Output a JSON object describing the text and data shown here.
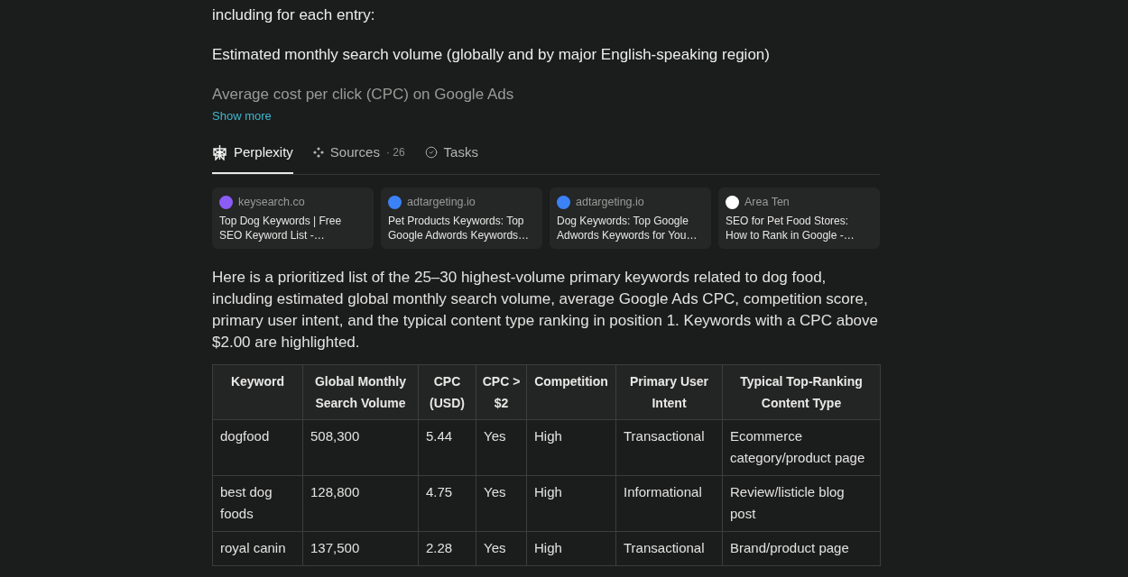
{
  "prompt": {
    "paragraphs": [
      "including for each entry:",
      "Estimated monthly search volume (globally and by major English-speaking region)",
      "Average cost per click (CPC) on Google Ads"
    ],
    "show_more": "Show more"
  },
  "tabs": [
    {
      "kind": "perplexity",
      "label": "Perplexity",
      "selected": true
    },
    {
      "kind": "sources",
      "label": "Sources",
      "count": "· 26",
      "selected": false
    },
    {
      "kind": "tasks",
      "label": "Tasks",
      "selected": false
    }
  ],
  "sources": [
    {
      "site": "keysearch.co",
      "title": "Top Dog Keywords | Free SEO Keyword List -…",
      "color": "#8b5cf6"
    },
    {
      "site": "adtargeting.io",
      "title": "Pet Products Keywords: Top Google Adwords Keywords…",
      "color": "#3b82f6"
    },
    {
      "site": "adtargeting.io",
      "title": "Dog Keywords: Top Google Adwords Keywords for You…",
      "color": "#3b82f6"
    },
    {
      "site": "Area Ten",
      "title": "SEO for Pet Food Stores: How to Rank in Google -…",
      "color": "#ffffff"
    }
  ],
  "answer": "Here is a prioritized list of the 25–30 highest-volume primary keywords related to dog food, including estimated global monthly search volume, average Google Ads CPC, competition score, primary user intent, and the typical content type ranking in position 1. Keywords with a CPC above $2.00 are highlighted.",
  "table": {
    "columns": [
      "Keyword",
      "Global Monthly Search Volume",
      "CPC (USD)",
      "CPC > $2",
      "Competition",
      "Primary User Intent",
      "Typical Top-Ranking Content Type"
    ],
    "rows": [
      [
        "dogfood",
        "508,300",
        "5.44",
        "Yes",
        "High",
        "Transactional",
        "Ecommerce category/product page"
      ],
      [
        "best dog foods",
        "128,800",
        "4.75",
        "Yes",
        "High",
        "Informational",
        "Review/listicle blog post"
      ],
      [
        "royal canin",
        "137,500",
        "2.28",
        "Yes",
        "High",
        "Transactional",
        "Brand/product page"
      ]
    ]
  }
}
